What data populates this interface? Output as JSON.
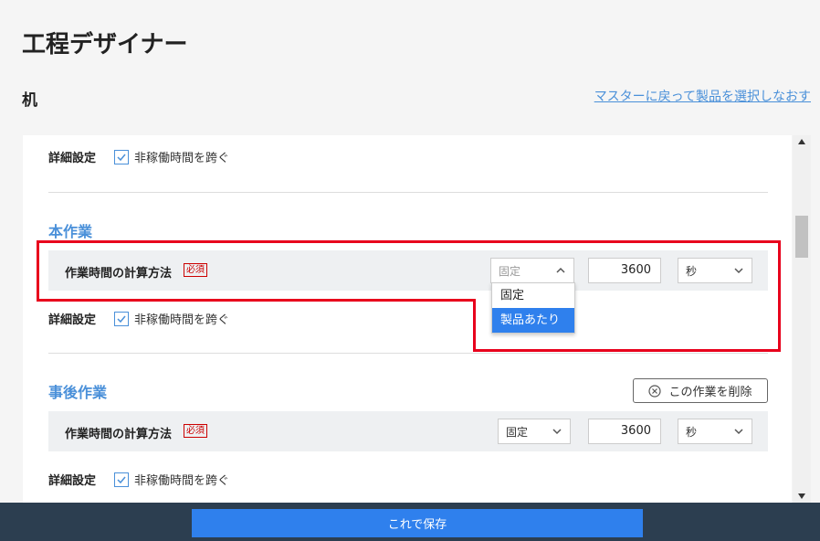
{
  "header": {
    "title": "工程デザイナー",
    "product_name": "机",
    "back_link": "マスターに戻って製品を選択しなおす"
  },
  "top_detail": {
    "label": "詳細設定",
    "checkbox_label": "非稼働時間を跨ぐ",
    "checked": true
  },
  "main_work": {
    "title": "本作業",
    "calc_label": "作業時間の計算方法",
    "required": "必須",
    "method_value": "固定",
    "time_value": "3600",
    "unit_value": "秒",
    "dropdown_options": [
      "固定",
      "製品あたり"
    ],
    "dropdown_highlighted": "製品あたり",
    "detail_label": "詳細設定",
    "checkbox_label": "非稼働時間を跨ぐ",
    "checked": true
  },
  "post_work": {
    "title": "事後作業",
    "delete_label": "この作業を削除",
    "calc_label": "作業時間の計算方法",
    "required": "必須",
    "method_value": "固定",
    "time_value": "3600",
    "unit_value": "秒",
    "detail_label": "詳細設定",
    "checkbox_label": "非稼働時間を跨ぐ",
    "checked": true
  },
  "footer": {
    "save_label": "これで保存"
  },
  "colors": {
    "accent": "#4a90d9",
    "highlight": "#e8001c",
    "footer_bg": "#2c3e50",
    "save_button": "#2f80ed"
  }
}
